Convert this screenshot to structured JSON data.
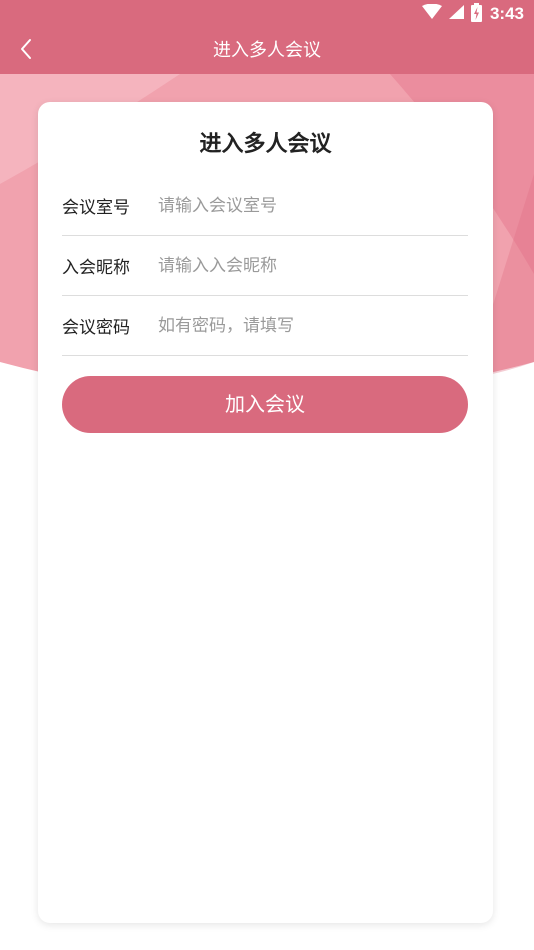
{
  "status_bar": {
    "time": "3:43"
  },
  "app_bar": {
    "title": "进入多人会议",
    "back_icon": "chevron-left-icon"
  },
  "card": {
    "title": "进入多人会议",
    "fields": [
      {
        "label": "会议室号",
        "value": "",
        "placeholder": "请输入会议室号"
      },
      {
        "label": "入会昵称",
        "value": "",
        "placeholder": "请输入入会昵称"
      },
      {
        "label": "会议密码",
        "value": "",
        "placeholder": "如有密码，请填写"
      }
    ],
    "join_label": "加入会议"
  },
  "colors": {
    "accent": "#d96a7e",
    "background_pink": "#f4a8b3",
    "text": "#222222",
    "placeholder": "#9a9a9a"
  }
}
